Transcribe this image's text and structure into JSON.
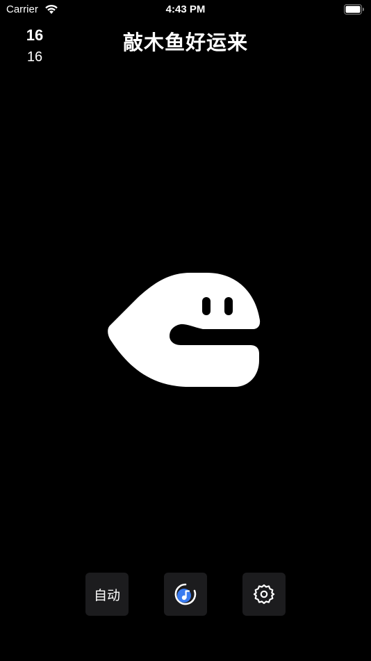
{
  "status_bar": {
    "carrier": "Carrier",
    "time": "4:43 PM"
  },
  "counter": {
    "main": "16",
    "sub": "16"
  },
  "title": "敲木鱼好运来",
  "fish": {
    "icon": "wooden-fish-icon",
    "color": "#ffffff"
  },
  "buttons": {
    "auto_label": "自动",
    "music_icon": "music-disc-icon",
    "music_accent": "#3a7bf0",
    "settings_icon": "gear-icon",
    "background": "#1c1c1e"
  }
}
